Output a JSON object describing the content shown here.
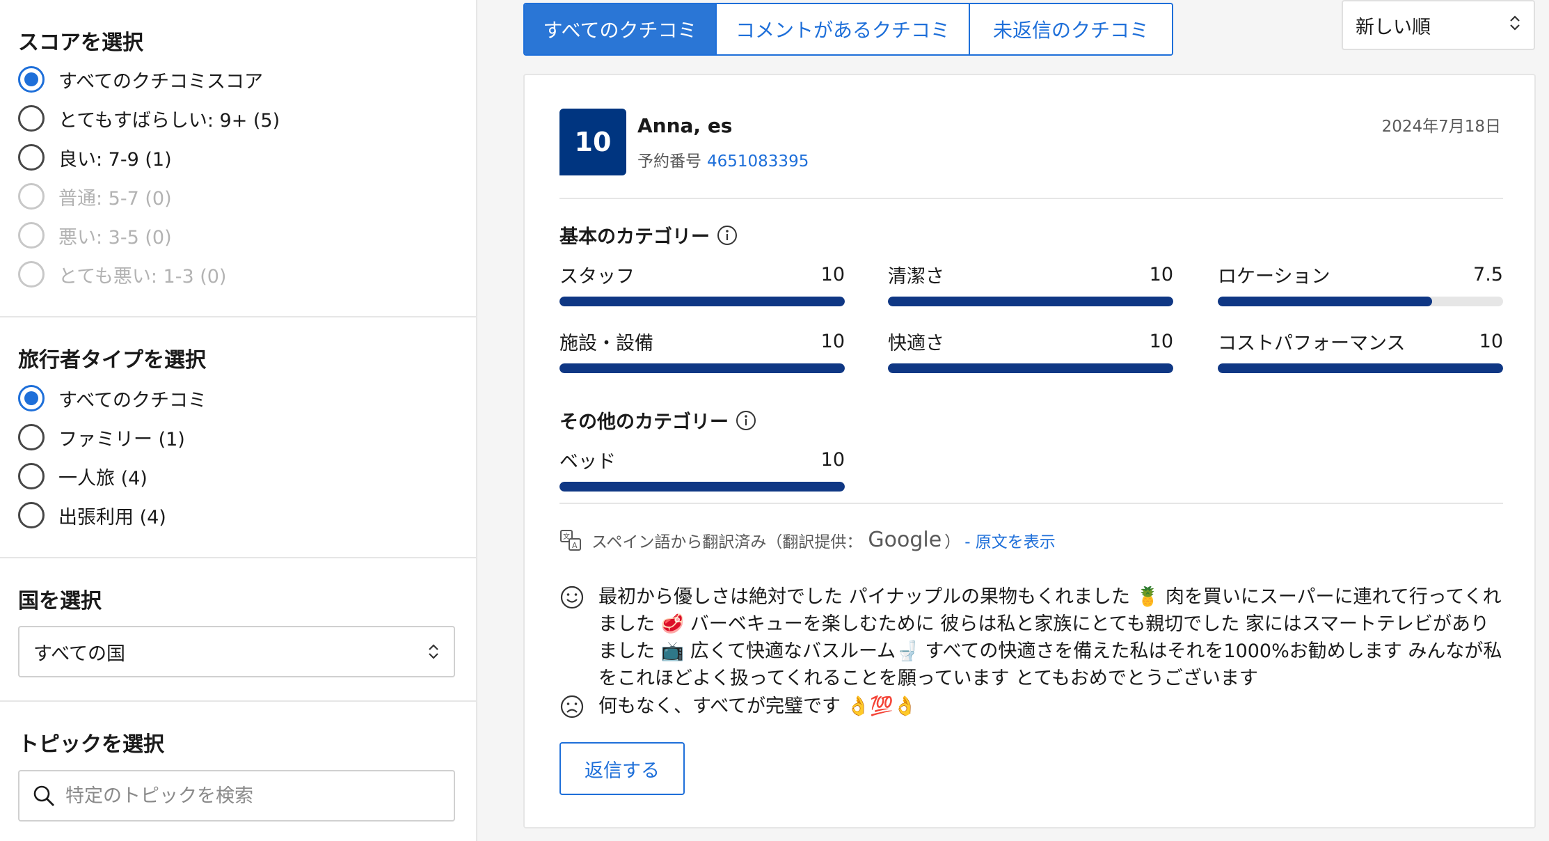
{
  "sidebar": {
    "score": {
      "title": "スコアを選択",
      "options": [
        {
          "label": "すべてのクチコミスコア",
          "checked": true,
          "disabled": false
        },
        {
          "label": "とてもすばらしい: 9+ (5)",
          "checked": false,
          "disabled": false
        },
        {
          "label": "良い: 7-9 (1)",
          "checked": false,
          "disabled": false
        },
        {
          "label": "普通: 5-7 (0)",
          "checked": false,
          "disabled": true
        },
        {
          "label": "悪い: 3-5 (0)",
          "checked": false,
          "disabled": true
        },
        {
          "label": "とても悪い: 1-3 (0)",
          "checked": false,
          "disabled": true
        }
      ]
    },
    "traveler": {
      "title": "旅行者タイプを選択",
      "options": [
        {
          "label": "すべてのクチコミ",
          "checked": true
        },
        {
          "label": "ファミリー (1)",
          "checked": false
        },
        {
          "label": "一人旅 (4)",
          "checked": false
        },
        {
          "label": "出張利用 (4)",
          "checked": false
        }
      ]
    },
    "country": {
      "title": "国を選択",
      "value": "すべての国"
    },
    "topic": {
      "title": "トピックを選択",
      "placeholder": "特定のトピックを検索"
    }
  },
  "tabs": [
    {
      "label": "すべてのクチコミ",
      "active": true
    },
    {
      "label": "コメントがあるクチコミ",
      "active": false
    },
    {
      "label": "未返信のクチコミ",
      "active": false
    }
  ],
  "sort": {
    "value": "新しい順"
  },
  "review": {
    "score": "10",
    "reviewer": "Anna, es",
    "booking_label": "予約番号",
    "booking_number": "4651083395",
    "date": "2024年7月18日",
    "basic_title": "基本のカテゴリー",
    "basic_categories": [
      {
        "label": "スタッフ",
        "score": "10",
        "fraction": 1.0
      },
      {
        "label": "清潔さ",
        "score": "10",
        "fraction": 1.0
      },
      {
        "label": "ロケーション",
        "score": "7.5",
        "fraction": 0.75
      },
      {
        "label": "施設・設備",
        "score": "10",
        "fraction": 1.0
      },
      {
        "label": "快適さ",
        "score": "10",
        "fraction": 1.0
      },
      {
        "label": "コストパフォーマンス",
        "score": "10",
        "fraction": 1.0
      }
    ],
    "other_title": "その他のカテゴリー",
    "other_categories": [
      {
        "label": "ベッド",
        "score": "10",
        "fraction": 1.0
      }
    ],
    "translation_note": "スペイン語から翻訳済み（翻訳提供：",
    "translation_provider": "Google",
    "translation_close": "）",
    "translation_link": "- 原文を表示",
    "positive": "最初から優しさは絶対でした パイナップルの果物もくれました 🍍 肉を買いにスーパーに連れて行ってくれました 🥩 バーベキューを楽しむために 彼らは私と家族にとても親切でした 家にはスマートテレビがありました 📺 広くて快適なバスルーム🚽 すべての快適さを備えた私はそれを1000%お勧めします みんなが私をこれほどよく扱ってくれることを願っています とてもおめでとうございます",
    "negative": "何もなく、すべてが完璧です 👌💯👌",
    "reply_label": "返信する"
  },
  "colors": {
    "accent": "#1e6fd9",
    "score_badge": "#003580",
    "bar_fill": "#0f3784"
  }
}
